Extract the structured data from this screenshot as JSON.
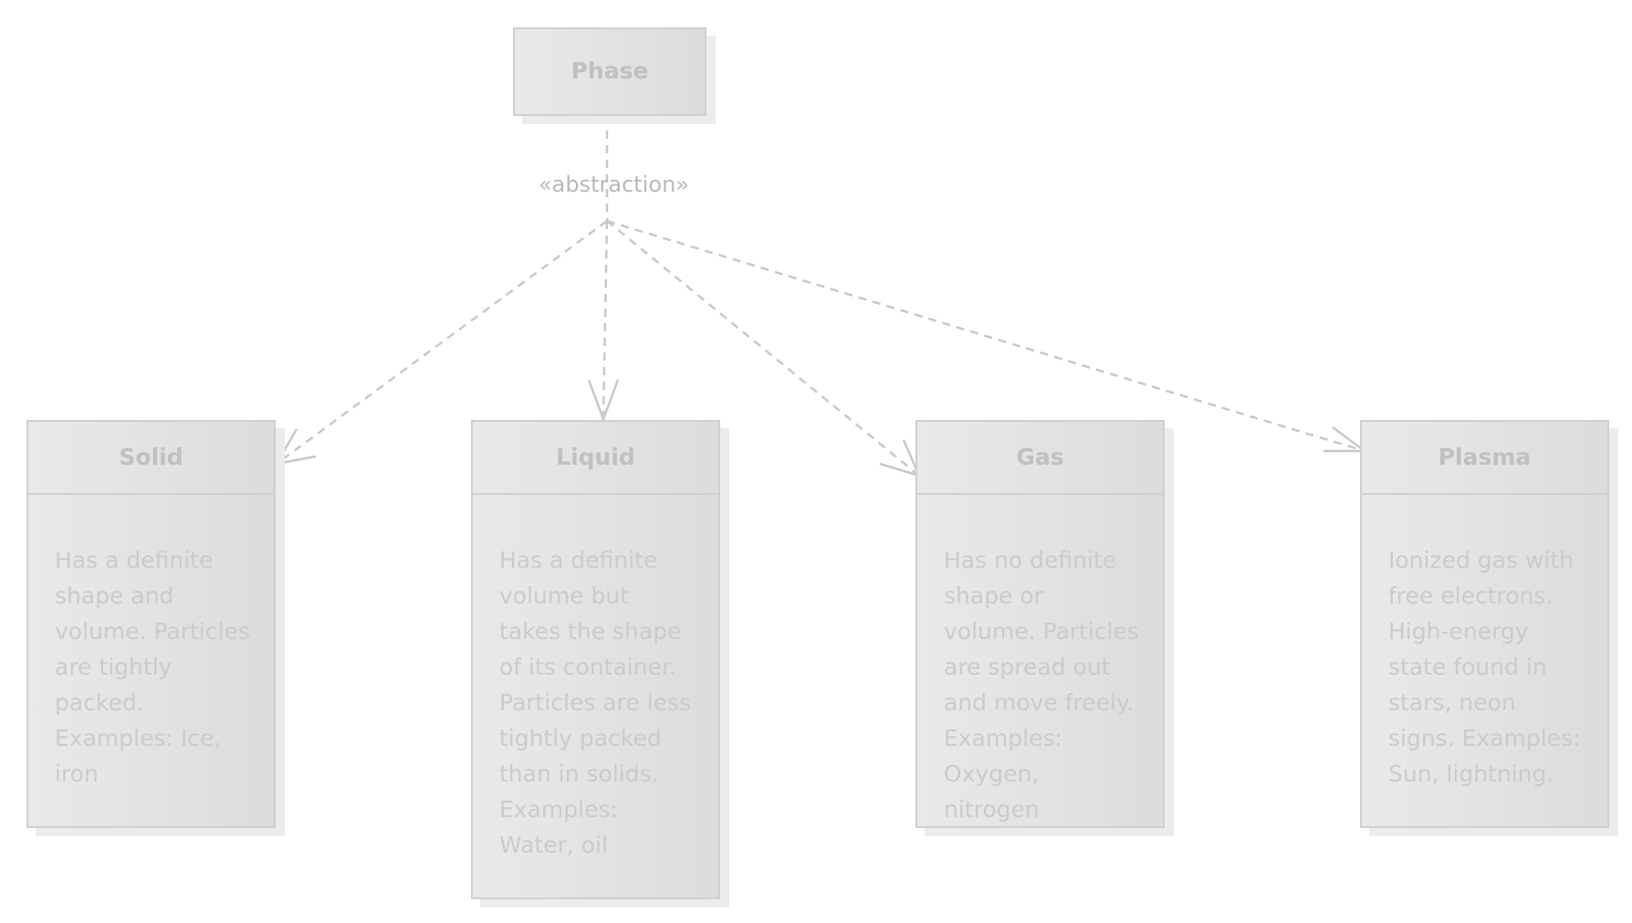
{
  "diagram": {
    "root": {
      "title": "Phase"
    },
    "relation_label": "«abstraction»",
    "children": [
      {
        "id": "solid",
        "title": "Solid",
        "description": "Has a definite shape and volume. Particles are tightly packed. Examples: Ice, iron"
      },
      {
        "id": "liquid",
        "title": "Liquid",
        "description": "Has a definite volume but takes the shape of its container. Particles are less tightly packed than in solids. Examples: Water, oil"
      },
      {
        "id": "gas",
        "title": "Gas",
        "description": "Has no definite shape or volume. Particles are spread out and move freely. Examples: Oxygen, nitrogen"
      },
      {
        "id": "plasma",
        "title": "Plasma",
        "description": "Ionized gas with free electrons. High-energy state found in stars, neon signs. Examples: Sun, lightning."
      }
    ],
    "colors": {
      "line": "#c8c8c8",
      "border": "#cfcfcf",
      "fill_left": "#e9e9e9",
      "fill_right": "#dcdcdc",
      "text": "#c0c0c0"
    }
  }
}
